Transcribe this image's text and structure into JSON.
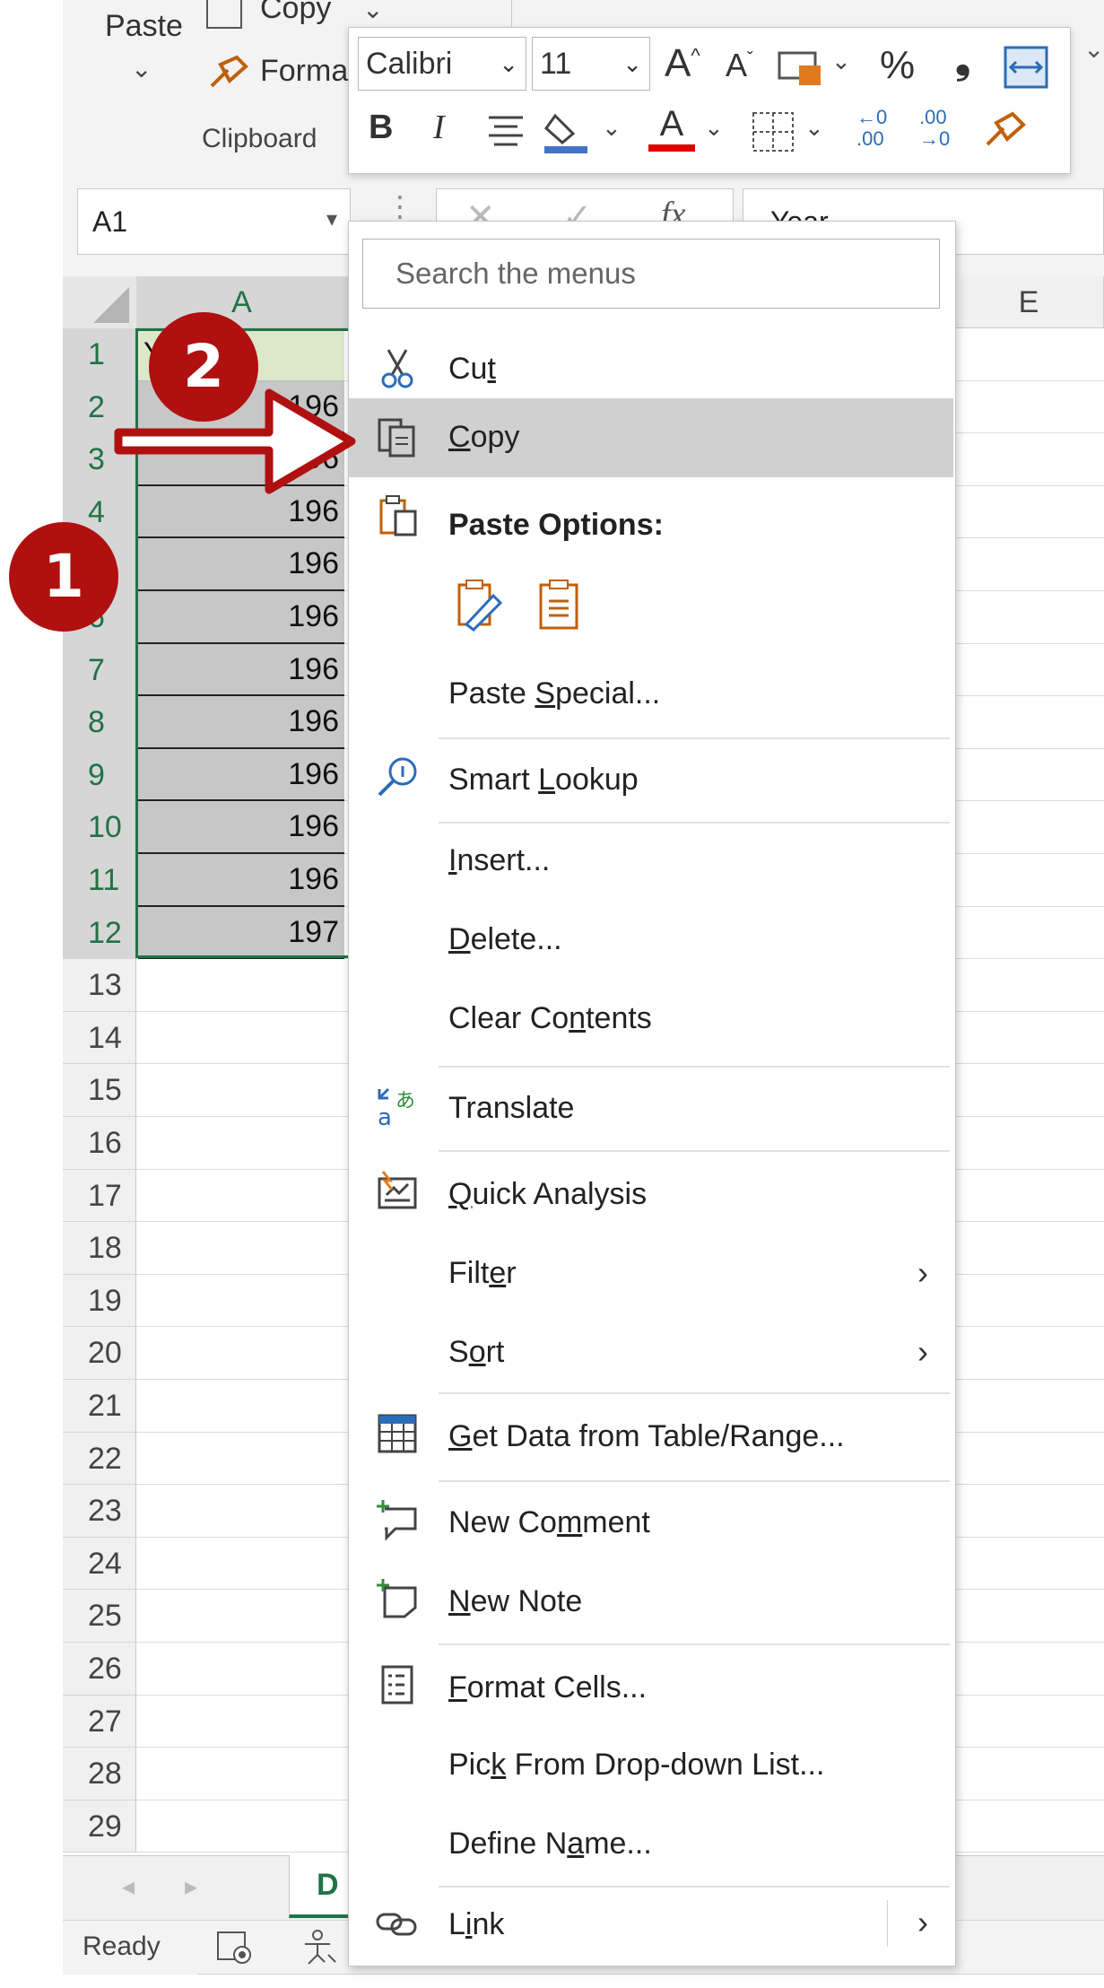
{
  "ribbon": {
    "paste_label": "Paste",
    "copy_label": "Copy",
    "format_painter_label": "Forma",
    "clipboard_group_label": "Clipboard"
  },
  "mini_toolbar": {
    "font_name": "Calibri",
    "font_size": "11",
    "percent_label": "%",
    "comma_label": "❟",
    "bold_label": "B",
    "italic_label": "I",
    "font_color_label": "A",
    "font_color": "#e00000",
    "fill_color": "#4472c4",
    "increase_decimal_label": "←0\n.00",
    "decrease_decimal_label": ".00\n→0"
  },
  "formula_bar": {
    "name_box": "A1",
    "formula_value": "Year",
    "fx_label": "fx"
  },
  "grid": {
    "columns": [
      "A",
      "E"
    ],
    "rows": [
      "1",
      "2",
      "3",
      "4",
      "5",
      "6",
      "7",
      "8",
      "9",
      "10",
      "11",
      "12",
      "13",
      "14",
      "15",
      "16",
      "17",
      "18",
      "19",
      "20",
      "21",
      "22",
      "23",
      "24",
      "25",
      "26",
      "27",
      "28",
      "29"
    ],
    "cells_a": [
      "Y",
      "196",
      "196",
      "196",
      "196",
      "196",
      "196",
      "196",
      "196",
      "196",
      "196",
      "197"
    ]
  },
  "context_menu": {
    "search_placeholder": "Search the menus",
    "items": [
      {
        "label_pre": "Cu",
        "label_u": "t",
        "label_post": "",
        "icon": "scissors-icon"
      },
      {
        "label_pre": "",
        "label_u": "C",
        "label_post": "opy",
        "icon": "copy-icon"
      },
      {
        "label_pre": "Paste Options:",
        "label_u": "",
        "label_post": "",
        "icon": "paste-icon"
      },
      {
        "label_pre": "Paste ",
        "label_u": "S",
        "label_post": "pecial...",
        "icon": ""
      },
      {
        "label_pre": "Smart ",
        "label_u": "L",
        "label_post": "ookup",
        "icon": "smart-lookup-icon"
      },
      {
        "label_pre": "",
        "label_u": "I",
        "label_post": "nsert...",
        "icon": ""
      },
      {
        "label_pre": "",
        "label_u": "D",
        "label_post": "elete...",
        "icon": ""
      },
      {
        "label_pre": "Clear Co",
        "label_u": "n",
        "label_post": "tents",
        "icon": ""
      },
      {
        "label_pre": "Translate",
        "label_u": "",
        "label_post": "",
        "icon": "translate-icon"
      },
      {
        "label_pre": "",
        "label_u": "Q",
        "label_post": "uick Analysis",
        "icon": "quick-analysis-icon"
      },
      {
        "label_pre": "Filt",
        "label_u": "e",
        "label_post": "r",
        "icon": ""
      },
      {
        "label_pre": "S",
        "label_u": "o",
        "label_post": "rt",
        "icon": ""
      },
      {
        "label_pre": "",
        "label_u": "G",
        "label_post": "et Data from Table/Range...",
        "icon": "table-icon"
      },
      {
        "label_pre": "New Co",
        "label_u": "m",
        "label_post": "ment",
        "icon": "new-comment-icon"
      },
      {
        "label_pre": "",
        "label_u": "N",
        "label_post": "ew Note",
        "icon": "new-note-icon"
      },
      {
        "label_pre": "",
        "label_u": "F",
        "label_post": "ormat Cells...",
        "icon": "format-cells-icon"
      },
      {
        "label_pre": "Pic",
        "label_u": "k",
        "label_post": " From Drop-down List...",
        "icon": ""
      },
      {
        "label_pre": "Define N",
        "label_u": "a",
        "label_post": "me...",
        "icon": ""
      },
      {
        "label_pre": "L",
        "label_u": "i",
        "label_post": "nk",
        "icon": "link-icon"
      }
    ]
  },
  "sheet_tab": {
    "label": "D"
  },
  "status_bar": {
    "status_text": "Ready"
  },
  "annotations": {
    "badge_1": "1",
    "badge_2": "2",
    "accent_color": "#b01010",
    "selection_color": "#217346"
  }
}
